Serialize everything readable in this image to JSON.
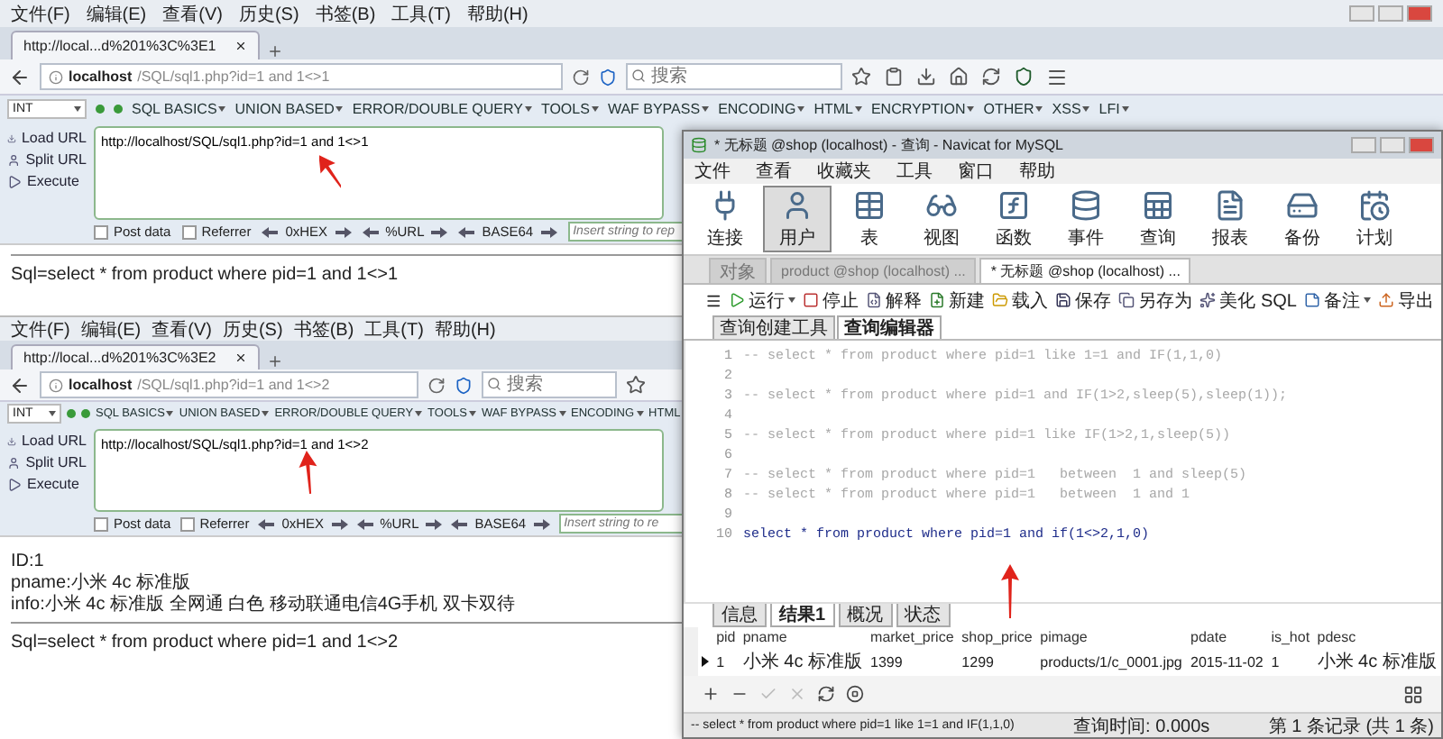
{
  "browsers": [
    {
      "menu": [
        "文件(F)",
        "编辑(E)",
        "查看(V)",
        "历史(S)",
        "书签(B)",
        "工具(T)",
        "帮助(H)"
      ],
      "tab": {
        "title": "http://local...d%201%3C%3E1"
      },
      "address": {
        "host": "localhost",
        "path": "/SQL/sql1.php?id=1 and 1<>1"
      },
      "search": {
        "placeholder": "搜索"
      },
      "hackbar": {
        "mode": "INT",
        "menus": [
          "SQL BASICS",
          "UNION BASED",
          "ERROR/DOUBLE QUERY",
          "TOOLS",
          "WAF BYPASS",
          "ENCODING",
          "HTML",
          "ENCRYPTION",
          "OTHER",
          "XSS",
          "LFI"
        ],
        "actions": [
          "Load URL",
          "Split URL",
          "Execute"
        ],
        "url": "http://localhost/SQL/sql1.php?id=1 and 1<>1",
        "options": [
          {
            "label": "Post data",
            "checked": false
          },
          {
            "label": "Referrer",
            "checked": false
          }
        ],
        "encoders": [
          "0xHEX",
          "%URL",
          "BASE64"
        ],
        "insert": {
          "placeholder": "Insert string to rep"
        }
      },
      "output": {
        "sql": "Sql=select * from product where pid=1 and 1<>1"
      }
    },
    {
      "menu": [
        "文件(F)",
        "编辑(E)",
        "查看(V)",
        "历史(S)",
        "书签(B)",
        "工具(T)",
        "帮助(H)"
      ],
      "tab": {
        "title": "http://local...d%201%3C%3E2"
      },
      "address": {
        "host": "localhost",
        "path": "/SQL/sql1.php?id=1 and 1<>2"
      },
      "search": {
        "placeholder": "搜索"
      },
      "hackbar": {
        "mode": "INT",
        "menus": [
          "SQL BASICS",
          "UNION BASED",
          "ERROR/DOUBLE QUERY",
          "TOOLS",
          "WAF BYPASS",
          "ENCODING",
          "HTML"
        ],
        "actions": [
          "Load URL",
          "Split URL",
          "Execute"
        ],
        "url": "http://localhost/SQL/sql1.php?id=1 and 1<>2",
        "options": [
          {
            "label": "Post data",
            "checked": false
          },
          {
            "label": "Referrer",
            "checked": false
          }
        ],
        "encoders": [
          "0xHEX",
          "%URL",
          "BASE64"
        ],
        "insert": {
          "placeholder": "Insert string to re"
        }
      },
      "output": {
        "lines": [
          "ID:1",
          "pname:小米 4c 标准版",
          "info:小米 4c 标准版 全网通 白色 移动联通电信4G手机 双卡双待"
        ],
        "sql": "Sql=select * from product where pid=1 and 1<>2"
      }
    }
  ],
  "navicat": {
    "title": "* 无标题 @shop (localhost) - 查询 - Navicat for MySQL",
    "menu": [
      "文件",
      "查看",
      "收藏夹",
      "工具",
      "窗口",
      "帮助"
    ],
    "toolbar": [
      {
        "label": "连接",
        "selected": false
      },
      {
        "label": "用户",
        "selected": true
      },
      {
        "label": "表",
        "selected": false
      },
      {
        "label": "视图",
        "selected": false
      },
      {
        "label": "函数",
        "selected": false
      },
      {
        "label": "事件",
        "selected": false
      },
      {
        "label": "查询",
        "selected": false
      },
      {
        "label": "报表",
        "selected": false
      },
      {
        "label": "备份",
        "selected": false
      },
      {
        "label": "计划",
        "selected": false
      }
    ],
    "tabs": [
      {
        "label": "对象",
        "selected": false
      },
      {
        "label": "product @shop (localhost) ...",
        "selected": false
      },
      {
        "label": "* 无标题 @shop (localhost) ...",
        "selected": true
      }
    ],
    "actions": [
      {
        "label": "运行",
        "menu": true
      },
      {
        "label": "停止",
        "menu": false
      },
      {
        "label": "解释",
        "menu": false
      },
      {
        "label": "新建",
        "menu": false
      },
      {
        "label": "载入",
        "menu": false
      },
      {
        "label": "保存",
        "menu": false
      },
      {
        "label": "另存为",
        "menu": false
      },
      {
        "label": "美化 SQL",
        "menu": false
      },
      {
        "label": "备注",
        "menu": true
      },
      {
        "label": "导出",
        "menu": false
      }
    ],
    "editor_tabs": [
      {
        "label": "查询创建工具",
        "selected": false
      },
      {
        "label": "查询编辑器",
        "selected": true
      }
    ],
    "lines": [
      {
        "number": "1",
        "kind": "comment",
        "text": "-- select * from product where pid=1 like 1=1 and IF(1,1,0)"
      },
      {
        "number": "2"
      },
      {
        "number": "3",
        "kind": "comment",
        "text": "-- select * from product where pid=1 and IF(1>2,sleep(5),sleep(1));"
      },
      {
        "number": "4"
      },
      {
        "number": "5",
        "kind": "comment",
        "text": "-- select * from product where pid=1 like IF(1>2,1,sleep(5))"
      },
      {
        "number": "6"
      },
      {
        "number": "7",
        "kind": "comment",
        "text": "-- select * from product where pid=1   between  1 and sleep(5)"
      },
      {
        "number": "8",
        "kind": "comment",
        "text": "-- select * from product where pid=1   between  1 and 1"
      },
      {
        "number": "9"
      },
      {
        "number": "10",
        "kind": "code",
        "text": "select * from product where pid=1 and if(1<>2,1,0)"
      }
    ],
    "result_tabs": [
      {
        "label": "信息",
        "selected": false
      },
      {
        "label": "结果1",
        "selected": true
      },
      {
        "label": "概况",
        "selected": false
      },
      {
        "label": "状态",
        "selected": false
      }
    ],
    "columns": [
      "pid",
      "pname",
      "market_price",
      "shop_price",
      "pimage",
      "pdate",
      "is_hot",
      "pdesc"
    ],
    "rows": [
      [
        "1",
        "小米 4c 标准版",
        "1399",
        "1299",
        "products/1/c_0001.jpg",
        "2015-11-02",
        "1",
        "小米 4c 标准版"
      ]
    ],
    "status": {
      "query": "-- select * from product where pid=1 like 1=1 and IF(1,1,0)",
      "time": "查询时间: 0.000s",
      "records": "第 1 条记录 (共 1 条)"
    }
  }
}
